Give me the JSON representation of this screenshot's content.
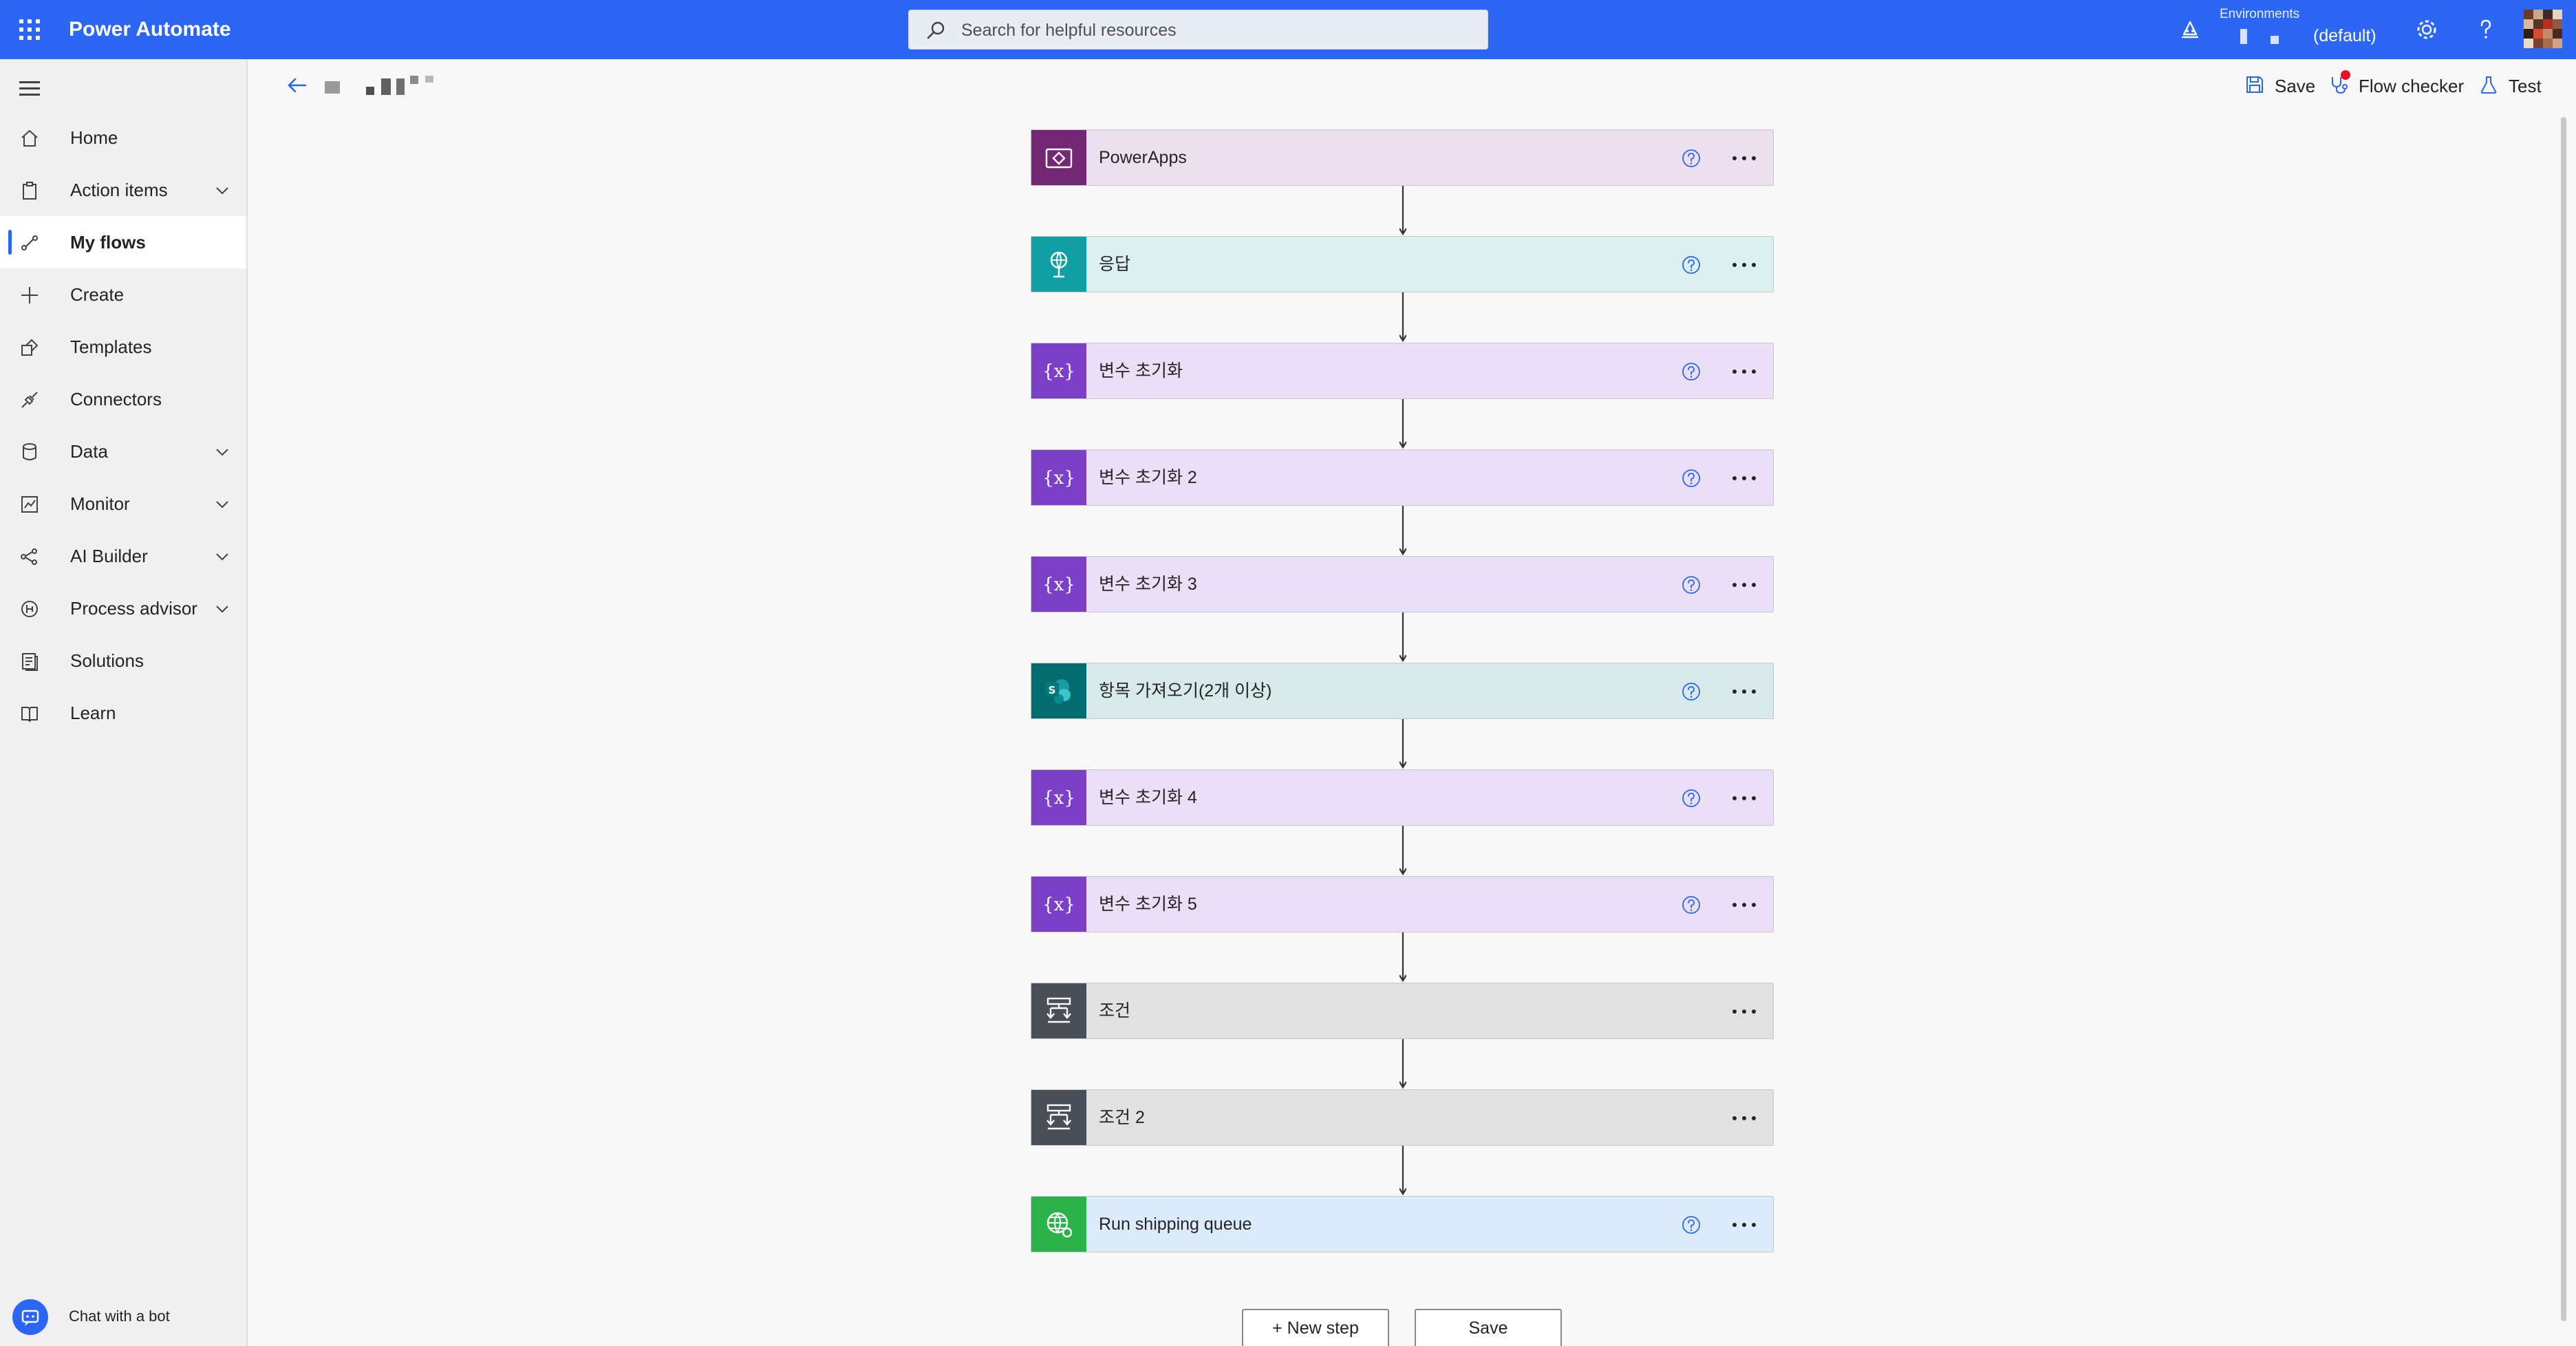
{
  "app": {
    "title": "Power Automate"
  },
  "search": {
    "placeholder": "Search for helpful resources"
  },
  "environment": {
    "label": "Environments",
    "value": "(default)"
  },
  "icons": {
    "waffle": "app-launcher-icon",
    "search": "search-icon",
    "assistant": "assistant-bot-icon",
    "settings": "gear-icon",
    "help": "question-mark-icon"
  },
  "nav": {
    "items": [
      {
        "label": "Home",
        "icon": "home-icon",
        "chevron": false,
        "active": false
      },
      {
        "label": "Action items",
        "icon": "clipboard-icon",
        "chevron": true,
        "active": false
      },
      {
        "label": "My flows",
        "icon": "flow-icon",
        "chevron": false,
        "active": true
      },
      {
        "label": "Create",
        "icon": "plus-icon",
        "chevron": false,
        "active": false
      },
      {
        "label": "Templates",
        "icon": "templates-icon",
        "chevron": false,
        "active": false
      },
      {
        "label": "Connectors",
        "icon": "connector-plug-icon",
        "chevron": false,
        "active": false
      },
      {
        "label": "Data",
        "icon": "database-icon",
        "chevron": true,
        "active": false
      },
      {
        "label": "Monitor",
        "icon": "monitor-chart-icon",
        "chevron": true,
        "active": false
      },
      {
        "label": "AI Builder",
        "icon": "ai-builder-icon",
        "chevron": true,
        "active": false
      },
      {
        "label": "Process advisor",
        "icon": "process-advisor-icon",
        "chevron": true,
        "active": false
      },
      {
        "label": "Solutions",
        "icon": "solutions-icon",
        "chevron": false,
        "active": false
      },
      {
        "label": "Learn",
        "icon": "book-icon",
        "chevron": false,
        "active": false
      }
    ],
    "chatbot_label": "Chat with a bot"
  },
  "commands": {
    "save": "Save",
    "flow_checker": "Flow checker",
    "test": "Test"
  },
  "colors": {
    "brand": "#2b66f5",
    "powerapps_tile": "#742774",
    "powerapps_bg": "#ecdff0",
    "response_tile": "#0f9fa4",
    "response_bg": "#daf0f1",
    "variable_tile": "#7b3fc8",
    "variable_bg": "#eadff7",
    "sharepoint_tile": "#036c70",
    "sharepoint_bg": "#d8e9e9",
    "condition_tile": "#484f58",
    "condition_bg": "#e1e1e1",
    "http_tile": "#2ab34a",
    "http_bg": "#dcebf9"
  },
  "steps": [
    {
      "title": "PowerApps",
      "kind": "powerapps",
      "help": true
    },
    {
      "title": "응답",
      "kind": "response",
      "help": true
    },
    {
      "title": "변수 초기화",
      "kind": "variable",
      "help": true
    },
    {
      "title": "변수 초기화 2",
      "kind": "variable",
      "help": true
    },
    {
      "title": "변수 초기화 3",
      "kind": "variable",
      "help": true
    },
    {
      "title": "항목 가져오기(2개 이상)",
      "kind": "sharepoint",
      "help": true
    },
    {
      "title": "변수 초기화 4",
      "kind": "variable",
      "help": true
    },
    {
      "title": "변수 초기화 5",
      "kind": "variable",
      "help": true
    },
    {
      "title": "조건",
      "kind": "condition",
      "help": false
    },
    {
      "title": "조건 2",
      "kind": "condition",
      "help": false
    },
    {
      "title": "Run shipping queue",
      "kind": "http",
      "help": true
    }
  ],
  "bottom": {
    "new_step": "+ New step",
    "save": "Save"
  }
}
